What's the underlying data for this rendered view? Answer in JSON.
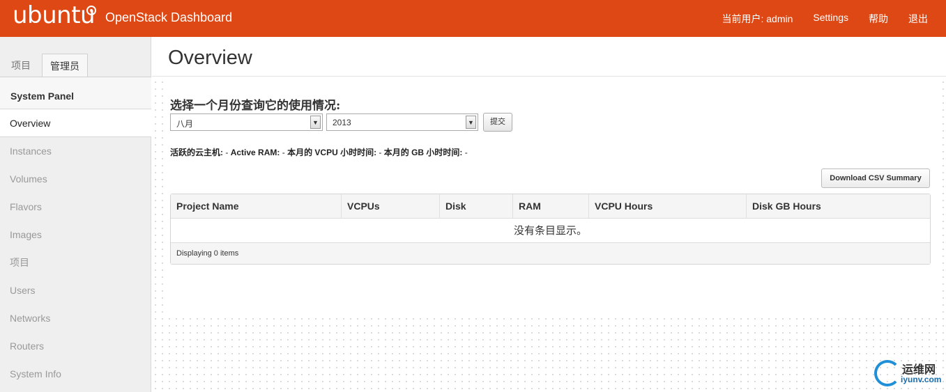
{
  "header": {
    "brand": "ubuntu",
    "app_title": "OpenStack Dashboard",
    "nav": {
      "current_user": "当前用户: admin",
      "settings": "Settings",
      "help": "帮助",
      "logout": "退出"
    },
    "bar_color": "#dd4814"
  },
  "sidebar": {
    "tabs": [
      "项目",
      "管理员"
    ],
    "active_tab": "管理员",
    "panel_title": "System Panel",
    "items": [
      "Overview",
      "Instances",
      "Volumes",
      "Flavors",
      "Images",
      "项目",
      "Users",
      "Networks",
      "Routers",
      "System Info"
    ],
    "active_item": "Overview"
  },
  "main": {
    "page_title": "Overview",
    "date_form": {
      "label": "选择一个月份查询它的使用情况:",
      "month_value": "八月",
      "year_value": "2013",
      "submit_label": "提交"
    },
    "summary": {
      "active_instances_label": "活跃的云主机:",
      "active_instances_value": "-",
      "active_ram_label": "Active RAM:",
      "active_ram_value": "-",
      "vcpu_hours_label": "本月的 VCPU 小时时间:",
      "vcpu_hours_value": "-",
      "gb_hours_label": "本月的 GB 小时时间:",
      "gb_hours_value": "-"
    },
    "csv_button": "Download CSV Summary",
    "table": {
      "columns": [
        "Project Name",
        "VCPUs",
        "Disk",
        "RAM",
        "VCPU Hours",
        "Disk GB Hours"
      ],
      "empty_message": "没有条目显示。",
      "footer": "Displaying 0 items"
    }
  },
  "watermark": {
    "cn": "运维网",
    "en": "iyunv.com"
  }
}
